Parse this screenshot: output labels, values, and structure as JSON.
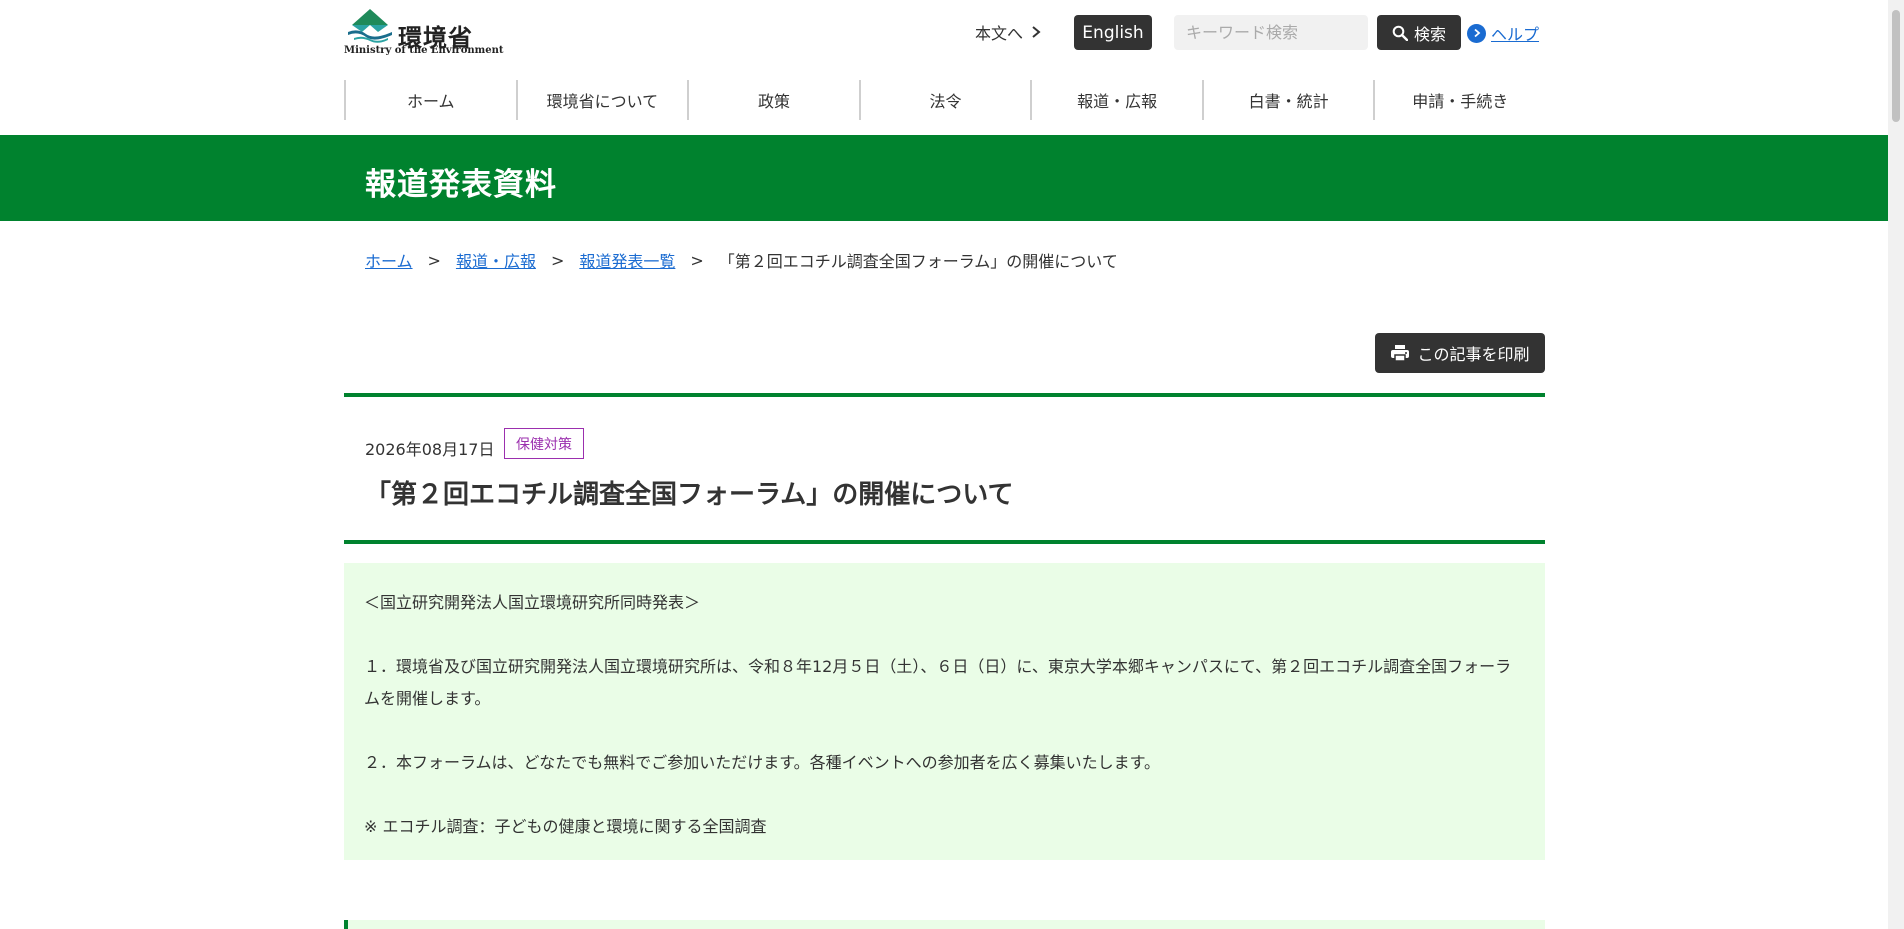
{
  "header": {
    "logo": {
      "jp": "環境省",
      "en": "Ministry of the Environment"
    },
    "skip_label": "本文へ",
    "english_label": "English",
    "search": {
      "placeholder": "キーワード検索",
      "button_label": "検索"
    },
    "help_label": "ヘルプ"
  },
  "nav": {
    "items": [
      {
        "label": "ホーム"
      },
      {
        "label": "環境省について"
      },
      {
        "label": "政策"
      },
      {
        "label": "法令"
      },
      {
        "label": "報道・広報"
      },
      {
        "label": "白書・統計"
      },
      {
        "label": "申請・手続き"
      }
    ]
  },
  "banner": {
    "title": "報道発表資料"
  },
  "breadcrumb": {
    "items": [
      {
        "label": "ホーム"
      },
      {
        "label": "報道・広報"
      },
      {
        "label": "報道発表一覧"
      }
    ],
    "current": "「第２回エコチル調査全国フォーラム」の開催について",
    "separator": ">"
  },
  "print_button": {
    "label": "この記事を印刷"
  },
  "article": {
    "date": "2026年08月17日",
    "tag": "保健対策",
    "title": "「第２回エコチル調査全国フォーラム」の開催について",
    "summary": [
      "＜国立研究開発法人国立環境研究所同時発表＞",
      "１．環境省及び国立研究開発法人国立環境研究所は、令和８年12月５日（土）、６日（日）に、東京大学本郷キャンパスにて、第２回エコチル調査全国フォーラムを開催します。",
      "２．本フォーラムは、どなたでも無料でご参加いただけます。各種イベントへの参加者を広く募集いたします。",
      "※ エコチル調査：子どもの健康と環境に関する全国調査"
    ]
  },
  "colors": {
    "brand_green": "#00822e",
    "summary_bg": "#eafde7",
    "link_blue": "#1a6bd1",
    "tag_purple": "#9b2fae",
    "dark_button": "#333333"
  },
  "icons": {
    "logo": "ministry-logo-icon",
    "skip": "chevron-right-icon",
    "search": "search-icon",
    "help": "chevron-right-circle-icon",
    "print": "printer-icon"
  }
}
